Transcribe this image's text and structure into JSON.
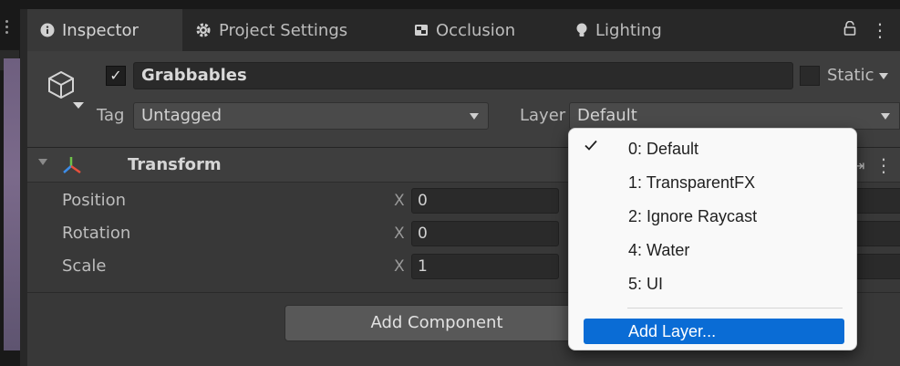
{
  "tabs": [
    {
      "label": "Inspector",
      "icon": "info-icon",
      "active": true
    },
    {
      "label": "Project Settings",
      "icon": "gear-icon",
      "active": false
    },
    {
      "label": "Occlusion",
      "icon": "occlusion-icon",
      "active": false
    },
    {
      "label": "Lighting",
      "icon": "lightbulb-icon",
      "active": false
    }
  ],
  "tab_menu": {
    "lock_icon": "lock-icon",
    "more_icon": "kebab-icon",
    "more_glyph": "⋮"
  },
  "game_object": {
    "active": true,
    "active_glyph": "✓",
    "name": "Grabbables",
    "static_label": "Static",
    "tag_label": "Tag",
    "tag_value": "Untagged",
    "layer_label": "Layer",
    "layer_value": "Default"
  },
  "transform": {
    "title": "Transform",
    "rows": [
      {
        "label": "Position",
        "axis": "X",
        "value": "0"
      },
      {
        "label": "Rotation",
        "axis": "X",
        "value": "0"
      },
      {
        "label": "Scale",
        "axis": "X",
        "value": "1"
      }
    ],
    "preset_glyph": "⇥",
    "more_glyph": "⋮"
  },
  "add_component_label": "Add Component",
  "layer_dropdown": {
    "items": [
      {
        "label": "0: Default",
        "selected": true
      },
      {
        "label": "1: TransparentFX",
        "selected": false
      },
      {
        "label": "2: Ignore Raycast",
        "selected": false
      },
      {
        "label": "4: Water",
        "selected": false
      },
      {
        "label": "5: UI",
        "selected": false
      }
    ],
    "add_layer_label": "Add Layer..."
  },
  "colors": {
    "panel_bg": "#383838",
    "header_bg": "#3e3e3e",
    "tab_bar_bg": "#282828",
    "highlight_blue": "#0a6cd5",
    "dropdown_bg": "#f9f9f9"
  }
}
